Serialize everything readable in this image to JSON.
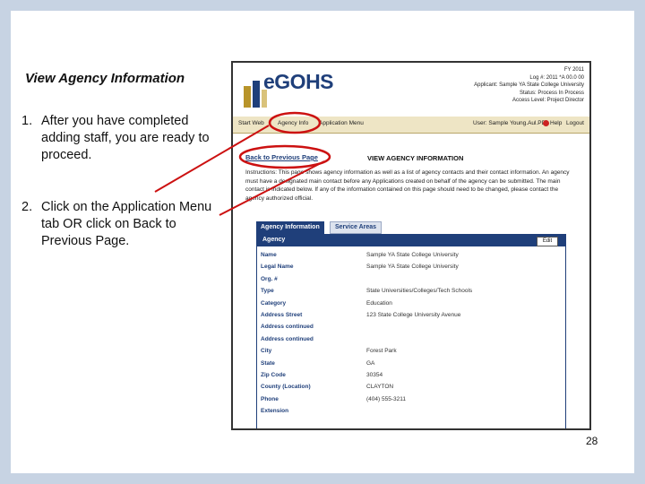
{
  "slide": {
    "heading": "View Agency Information",
    "steps": [
      {
        "num": "1.",
        "text": "After you have completed adding staff, you are ready to proceed."
      },
      {
        "num": "2.",
        "text": "Click on the Application Menu tab OR click on Back to Previous Page."
      }
    ],
    "page_number": "28"
  },
  "screenshot": {
    "logo": "eGOHS",
    "header_info": [
      "FY 2011",
      "Log #: 2011 *A 00.0 00",
      "Applicant: Sample YA State College University",
      "Status: Process In Process",
      "Access Level: Project Director"
    ],
    "nav_tabs": [
      "Start Web",
      "Agency Info",
      "Application Menu"
    ],
    "nav_user": "User: Sample Young.Aul.PD",
    "nav_help": "Help",
    "nav_logout": "Logout",
    "back_link": "Back to Previous Page",
    "view_title": "VIEW AGENCY INFORMATION",
    "instructions": "Instructions: This page shows agency information as well as a list of agency contacts and their contact information. An agency must have a designated main contact before any Applications created on behalf of the agency can be submitted. The main contact is indicated below. If any of the information contained on this page should need to be changed, please contact the agency authorized official.",
    "tab_active": "Agency Information",
    "tab_inactive": "Service Areas",
    "panel_title": "Agency",
    "edit_label": "Edit",
    "fields": [
      {
        "label": "Name",
        "value": "Sample YA State College University"
      },
      {
        "label": "Legal Name",
        "value": "Sample YA State College University"
      },
      {
        "label": "Org. #",
        "value": ""
      },
      {
        "label": "Type",
        "value": "State Universities/Colleges/Tech Schools"
      },
      {
        "label": "Category",
        "value": "Education"
      },
      {
        "label": "Address Street",
        "value": "123 State College University Avenue"
      },
      {
        "label": "Address continued",
        "value": ""
      },
      {
        "label": "Address continued",
        "value": ""
      },
      {
        "label": "City",
        "value": "Forest Park"
      },
      {
        "label": "State",
        "value": "GA"
      },
      {
        "label": "Zip Code",
        "value": "30354"
      },
      {
        "label": "County (Location)",
        "value": "CLAYTON"
      },
      {
        "label": "Phone",
        "value": "(404) 555-3211"
      },
      {
        "label": "Extension",
        "value": ""
      }
    ]
  },
  "colors": {
    "frame": "#c7d3e3",
    "brand_navy": "#1f3f7a",
    "nav_bg": "#eee5c5",
    "annotation_red": "#cc1111"
  }
}
